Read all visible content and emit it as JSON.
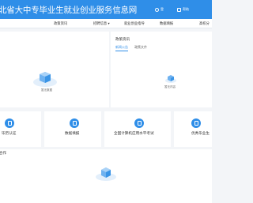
{
  "header": {
    "site_title": "北省大中专毕业生就业创业服务信息网",
    "btn_1": "登",
    "btn_2": "帮助"
  },
  "nav": {
    "items": [
      "政策资讯",
      "招聘信息",
      "就业创业指导",
      "数据填报",
      "高校分"
    ]
  },
  "left_panel": {
    "empty_caption": "暂无数据"
  },
  "news": {
    "title": "政策资讯",
    "tabs": [
      "新闻公告",
      "政策文件"
    ],
    "empty_caption": "暂无内容"
  },
  "quick_links": [
    "毕历认证",
    "数据填报",
    "全国计算机应用水平考试",
    "优秀毕业生"
  ],
  "bottom": {
    "title": "合作"
  },
  "colors": {
    "brand_blue": "#2f8ee8",
    "page_bg": "#f3f5f8"
  }
}
